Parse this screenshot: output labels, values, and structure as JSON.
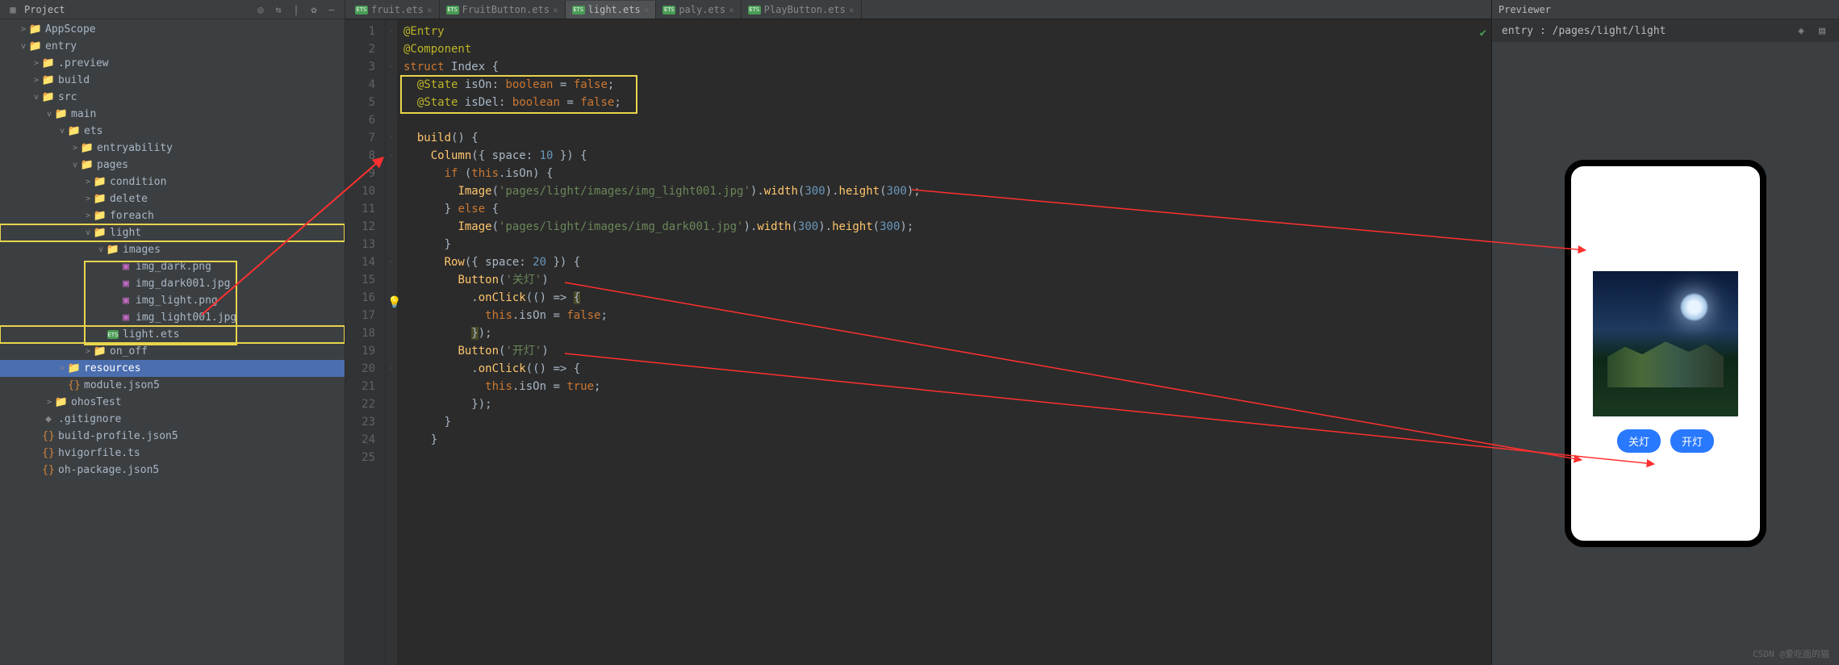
{
  "sidebar": {
    "title": "Project",
    "tree": [
      {
        "indent": 1,
        "tw": ">",
        "ic": "folder",
        "label": "AppScope"
      },
      {
        "indent": 1,
        "tw": "v",
        "ic": "folder-b",
        "label": "entry",
        "cls": "selected"
      },
      {
        "indent": 2,
        "tw": ">",
        "ic": "folder-o",
        "label": ".preview"
      },
      {
        "indent": 2,
        "tw": ">",
        "ic": "folder-o",
        "label": "build"
      },
      {
        "indent": 2,
        "tw": "v",
        "ic": "folder-b",
        "label": "src"
      },
      {
        "indent": 3,
        "tw": "v",
        "ic": "folder",
        "label": "main"
      },
      {
        "indent": 4,
        "tw": "v",
        "ic": "folder",
        "label": "ets"
      },
      {
        "indent": 5,
        "tw": ">",
        "ic": "folder",
        "label": "entryability"
      },
      {
        "indent": 5,
        "tw": "v",
        "ic": "folder",
        "label": "pages"
      },
      {
        "indent": 6,
        "tw": ">",
        "ic": "folder",
        "label": "condition"
      },
      {
        "indent": 6,
        "tw": ">",
        "ic": "folder",
        "label": "delete"
      },
      {
        "indent": 6,
        "tw": ">",
        "ic": "folder",
        "label": "foreach"
      },
      {
        "indent": 6,
        "tw": "v",
        "ic": "folder",
        "label": "light",
        "hl": true
      },
      {
        "indent": 7,
        "tw": "v",
        "ic": "folder",
        "label": "images",
        "hlStart": true
      },
      {
        "indent": 8,
        "tw": "",
        "ic": "img",
        "label": "img_dark.png"
      },
      {
        "indent": 8,
        "tw": "",
        "ic": "img",
        "label": "img_dark001.jpg"
      },
      {
        "indent": 8,
        "tw": "",
        "ic": "img",
        "label": "img_light.png"
      },
      {
        "indent": 8,
        "tw": "",
        "ic": "img",
        "label": "img_light001.jpg",
        "hlEnd": true
      },
      {
        "indent": 7,
        "tw": "",
        "ic": "ets",
        "label": "light.ets",
        "hl": true
      },
      {
        "indent": 6,
        "tw": ">",
        "ic": "folder",
        "label": "on_off"
      },
      {
        "indent": 4,
        "tw": ">",
        "ic": "folder",
        "label": "resources",
        "selected": true
      },
      {
        "indent": 4,
        "tw": "",
        "ic": "json",
        "label": "module.json5"
      },
      {
        "indent": 3,
        "tw": ">",
        "ic": "folder",
        "label": "ohosTest"
      },
      {
        "indent": 2,
        "tw": "",
        "ic": "git",
        "label": ".gitignore"
      },
      {
        "indent": 2,
        "tw": "",
        "ic": "json",
        "label": "build-profile.json5"
      },
      {
        "indent": 2,
        "tw": "",
        "ic": "json",
        "label": "hvigorfile.ts"
      },
      {
        "indent": 2,
        "tw": "",
        "ic": "json",
        "label": "oh-package.json5"
      }
    ]
  },
  "tabs": [
    {
      "label": "fruit.ets",
      "active": false
    },
    {
      "label": "FruitButton.ets",
      "active": false
    },
    {
      "label": "light.ets",
      "active": true
    },
    {
      "label": "paly.ets",
      "active": false
    },
    {
      "label": "PlayButton.ets",
      "active": false
    }
  ],
  "code": {
    "lines": [
      {
        "n": 1,
        "html": "<span class='ann'>@Entry</span>"
      },
      {
        "n": 2,
        "html": "<span class='ann'>@Component</span>"
      },
      {
        "n": 3,
        "html": "<span class='kw'>struct</span> <span class='cls'>Index</span> {"
      },
      {
        "n": 4,
        "html": "  <span class='ann'>@State</span> <span class='type'>isOn</span>: <span class='kw'>boolean</span> = <span class='kw'>false</span>;"
      },
      {
        "n": 5,
        "html": "  <span class='ann'>@State</span> <span class='type'>isDel</span>: <span class='kw'>boolean</span> = <span class='kw'>false</span>;"
      },
      {
        "n": 6,
        "html": ""
      },
      {
        "n": 7,
        "html": "  <span class='fn'>build</span>() {"
      },
      {
        "n": 8,
        "html": "    <span class='fn'>Column</span>({ space: <span class='num'>10</span> }) {"
      },
      {
        "n": 9,
        "html": "      <span class='kw'>if</span> (<span class='kw'>this</span>.isOn) {"
      },
      {
        "n": 10,
        "html": "        <span class='fn'>Image</span>(<span class='str'>'pages/light/images/img_light001.jpg'</span>).<span class='fn'>width</span>(<span class='num'>300</span>).<span class='fn'>height</span>(<span class='num'>300</span>);"
      },
      {
        "n": 11,
        "html": "      } <span class='kw'>else</span> {"
      },
      {
        "n": 12,
        "html": "        <span class='fn'>Image</span>(<span class='str'>'pages/light/images/img_dark001.jpg'</span>).<span class='fn'>width</span>(<span class='num'>300</span>).<span class='fn'>height</span>(<span class='num'>300</span>);"
      },
      {
        "n": 13,
        "html": "      }"
      },
      {
        "n": 14,
        "html": "      <span class='fn'>Row</span>({ space: <span class='num'>20</span> }) {"
      },
      {
        "n": 15,
        "html": "        <span class='fn'>Button</span>(<span class='str'>'关灯'</span>)"
      },
      {
        "n": 16,
        "html": "          .<span class='fn'>onClick</span>(() => <span style='background:#4a4a2a'>{</span>"
      },
      {
        "n": 17,
        "html": "            <span class='kw'>this</span>.isOn = <span class='kw'>false</span>;"
      },
      {
        "n": 18,
        "html": "          <span style='background:#4a4a2a'>}</span>);"
      },
      {
        "n": 19,
        "html": "        <span class='fn'>Button</span>(<span class='str'>'开灯'</span>)"
      },
      {
        "n": 20,
        "html": "          .<span class='fn'>onClick</span>(() => {"
      },
      {
        "n": 21,
        "html": "            <span class='kw'>this</span>.isOn = <span class='kw'>true</span>;"
      },
      {
        "n": 22,
        "html": "          });"
      },
      {
        "n": 23,
        "html": "      }"
      },
      {
        "n": 24,
        "html": "    }"
      },
      {
        "n": 25,
        "html": ""
      }
    ],
    "folds": {
      "1": "-",
      "3": "-",
      "7": "-",
      "8": "-",
      "14": "-",
      "16": "-",
      "20": "-"
    }
  },
  "previewer": {
    "title": "Previewer",
    "path": "entry : /pages/light/light",
    "btn_off": "关灯",
    "btn_on": "开灯"
  },
  "watermark": "CSDN @爱吃面的猫"
}
